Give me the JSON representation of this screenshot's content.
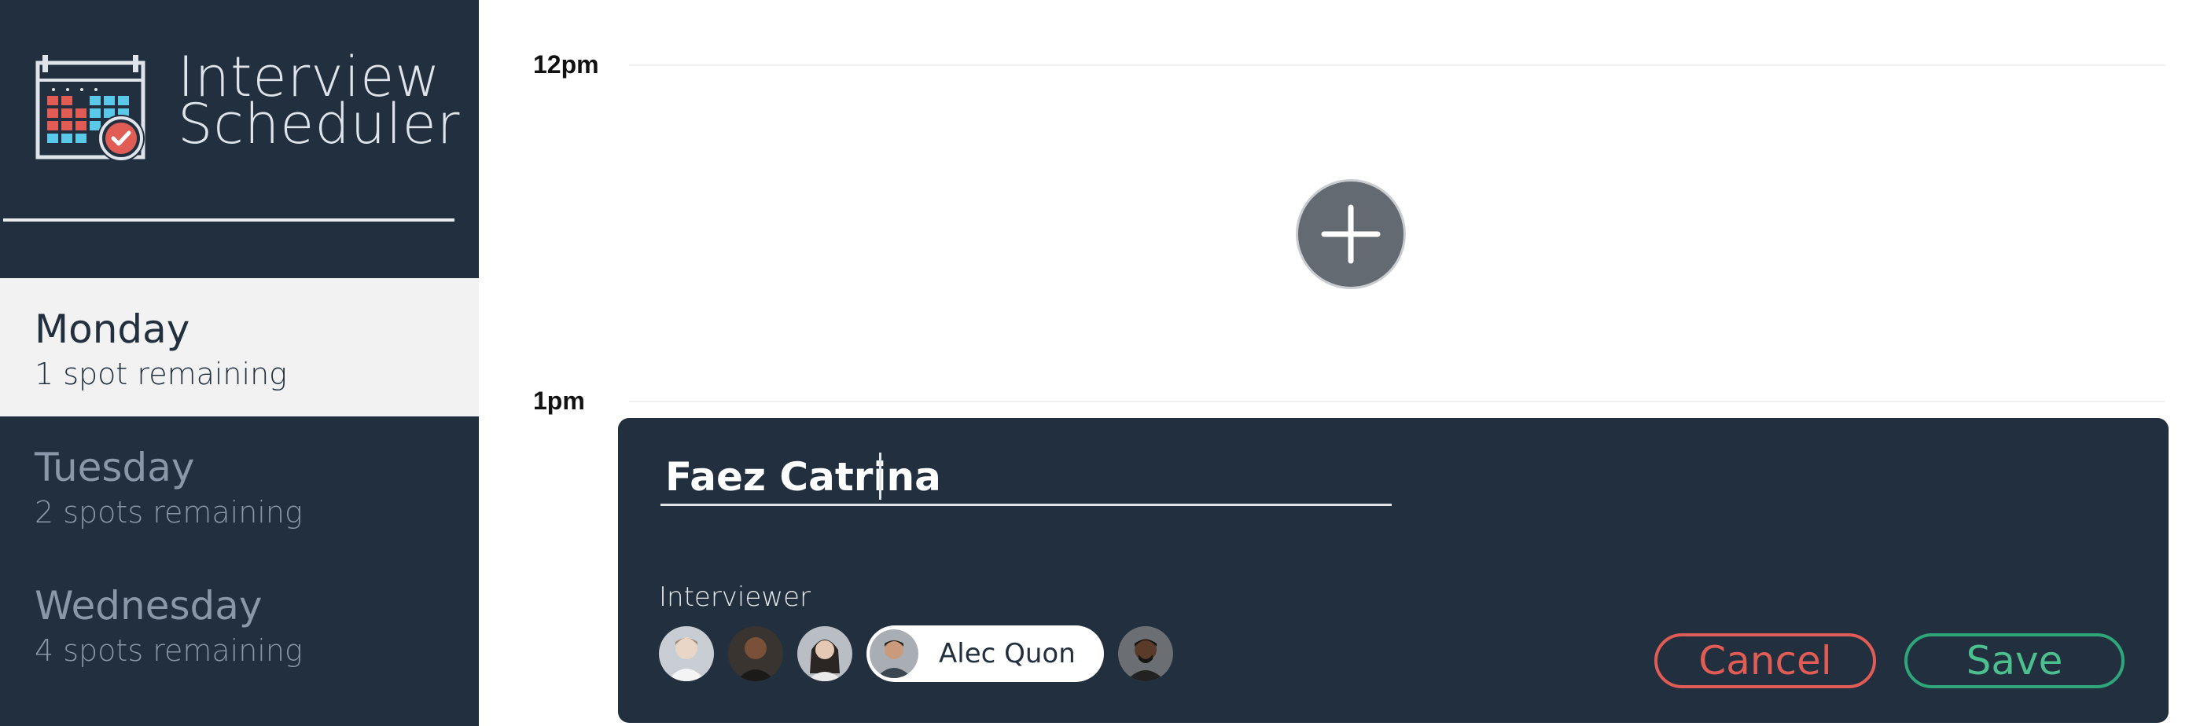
{
  "app": {
    "title_line1": "Interview",
    "title_line2": "Scheduler"
  },
  "days": [
    {
      "name": "Monday",
      "spots": "1 spot remaining",
      "state": "selected"
    },
    {
      "name": "Tuesday",
      "spots": "2 spots remaining",
      "state": "default"
    },
    {
      "name": "Wednesday",
      "spots": "4 spots remaining",
      "state": "default"
    }
  ],
  "schedule": {
    "times": [
      "12pm",
      "1pm"
    ],
    "add_icon": "plus-icon"
  },
  "form": {
    "student_name": "Faez Catrina",
    "interviewer_label": "Interviewer",
    "interviewers": [
      {
        "name": "",
        "selected": false,
        "icon": "avatar-1"
      },
      {
        "name": "",
        "selected": false,
        "icon": "avatar-2"
      },
      {
        "name": "",
        "selected": false,
        "icon": "avatar-3"
      },
      {
        "name": "Alec Quon",
        "selected": true,
        "icon": "avatar-4"
      },
      {
        "name": "",
        "selected": false,
        "icon": "avatar-5"
      }
    ],
    "cancel_label": "Cancel",
    "save_label": "Save"
  },
  "colors": {
    "sidebar_bg": "#222f3e",
    "selected_day_bg": "#f2f2f2",
    "cancel": "#e05c55",
    "save": "#4cbf8f"
  }
}
